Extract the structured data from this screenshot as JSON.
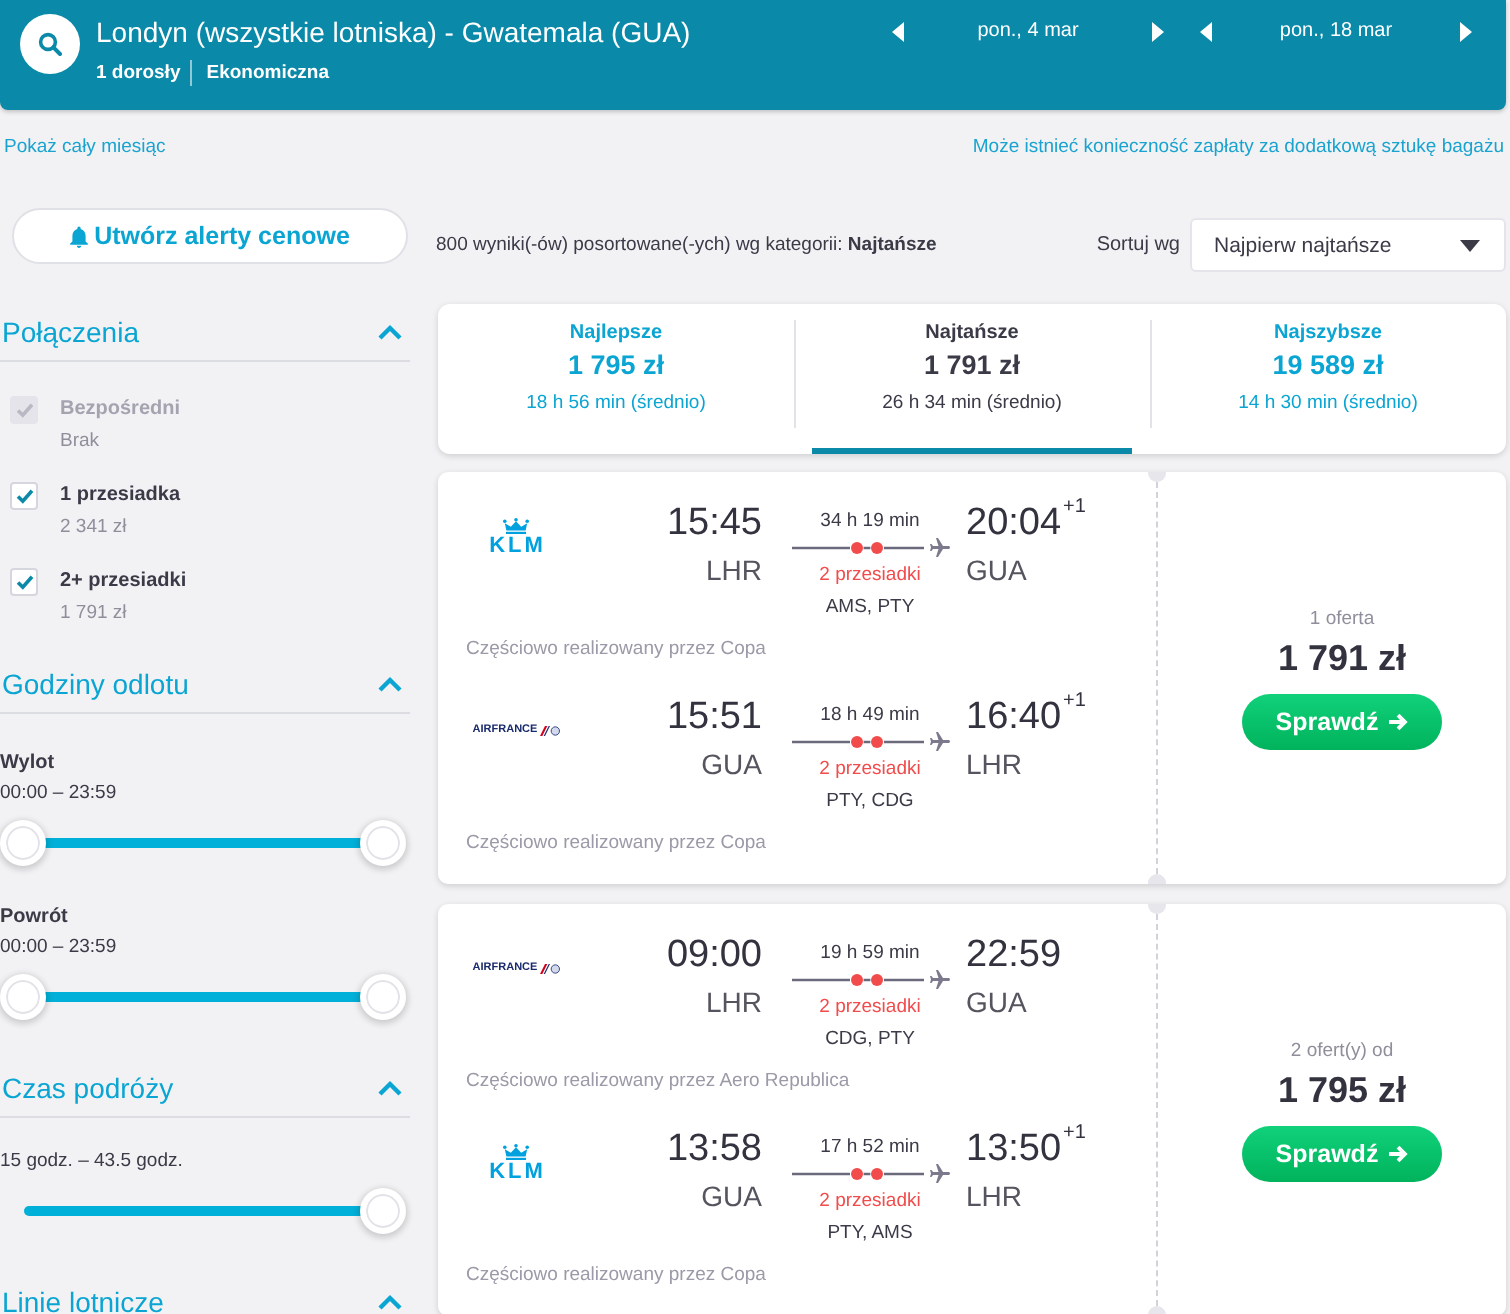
{
  "header": {
    "title": "Londyn (wszystkie lotniska) - Gwatemala (GUA)",
    "passengers": "1 dorosły",
    "cabin": "Ekonomiczna",
    "dates": [
      {
        "label": "pon., 4 mar"
      },
      {
        "label": "pon., 18 mar"
      }
    ]
  },
  "links": {
    "month": "Pokaż cały miesiąc",
    "baggage_note": "Może istnieć konieczność zapłaty za dodatkową sztukę bagażu"
  },
  "sidebar": {
    "alert_button": "Utwórz alerty cenowe",
    "sections": [
      {
        "kind": "checkboxes",
        "title": "Połączenia",
        "expanded": true,
        "items": [
          {
            "label": "Bezpośredni",
            "sub": "Brak",
            "checked": true,
            "disabled": true
          },
          {
            "label": "1 przesiadka",
            "sub": "2 341 zł",
            "checked": true,
            "disabled": false
          },
          {
            "label": "2+ przesiadki",
            "sub": "1 791 zł",
            "checked": true,
            "disabled": false
          }
        ]
      },
      {
        "kind": "sliders",
        "title": "Godziny odlotu",
        "expanded": true,
        "sliders": [
          {
            "label": "Wylot",
            "range": "00:00 – 23:59",
            "thumbs": [
              {
                "level": 0
              },
              {
                "level": 1
              }
            ]
          },
          {
            "label": "Powrót",
            "range": "00:00 – 23:59",
            "thumbs": [
              {
                "level": 0
              },
              {
                "level": 1
              }
            ]
          }
        ]
      },
      {
        "kind": "sliders",
        "title": "Czas podróży",
        "expanded": true,
        "sliders": [
          {
            "range": "15 godz. – 43.5 godz.",
            "thumbs": [
              {
                "level": 1
              }
            ]
          }
        ]
      },
      {
        "title": "Linie lotnicze",
        "expanded": true
      }
    ]
  },
  "results": {
    "summary": "800 wyniki(-ów) posortowane(-ych) wg kategorii: **Najtańsze**",
    "sort_label": "Sortuj wg",
    "sort_value": "Najpierw najtańsze"
  },
  "tabs": [
    {
      "label": "Najlepsze",
      "price": "1 795 zł",
      "duration": "18 h 56 min (średnio)",
      "selected": false
    },
    {
      "label": "Najtańsze",
      "price": "1 791 zł",
      "duration": "26 h 34 min (średnio)",
      "selected": true
    },
    {
      "label": "Najszybsze",
      "price": "19 589 zł",
      "duration": "14 h 30 min (średnio)",
      "selected": false
    }
  ],
  "offers": [
    {
      "legs": [
        {
          "airline": {
            "kind": "crown",
            "logo_text": "KLM"
          },
          "depart_time": "15:45",
          "depart_airport": "LHR",
          "duration": "34 h 19 min",
          "stops": "2 przesiadki",
          "via": "AMS, PTY",
          "arrive_time": "20:04",
          "day_offset": "+1",
          "arrive_airport": "GUA",
          "operated_by": "Częściowo realizowany przez Copa"
        },
        {
          "airline": {
            "kind": "stripes",
            "logo_text": "AIRFRANCE"
          },
          "depart_time": "15:51",
          "depart_airport": "GUA",
          "duration": "18 h 49 min",
          "stops": "2 przesiadki",
          "via": "PTY, CDG",
          "arrive_time": "16:40",
          "day_offset": "+1",
          "arrive_airport": "LHR",
          "operated_by": "Częściowo realizowany przez Copa"
        }
      ],
      "offer_count": "1 oferta",
      "price": "1 791 zł",
      "button": "Sprawdź"
    },
    {
      "legs": [
        {
          "airline": {
            "kind": "stripes",
            "logo_text": "AIRFRANCE"
          },
          "depart_time": "09:00",
          "depart_airport": "LHR",
          "duration": "19 h 59 min",
          "stops": "2 przesiadki",
          "via": "CDG, PTY",
          "arrive_time": "22:59",
          "arrive_airport": "GUA",
          "operated_by": "Częściowo realizowany przez Aero Republica"
        },
        {
          "airline": {
            "kind": "crown",
            "logo_text": "KLM"
          },
          "depart_time": "13:58",
          "depart_airport": "GUA",
          "duration": "17 h 52 min",
          "stops": "2 przesiadki",
          "via": "PTY, AMS",
          "arrive_time": "13:50",
          "day_offset": "+1",
          "arrive_airport": "LHR",
          "operated_by": "Częściowo realizowany przez Copa"
        }
      ],
      "offer_count": "2 ofert(y) od",
      "price": "1 795 zł",
      "button": "Sprawdź"
    }
  ]
}
